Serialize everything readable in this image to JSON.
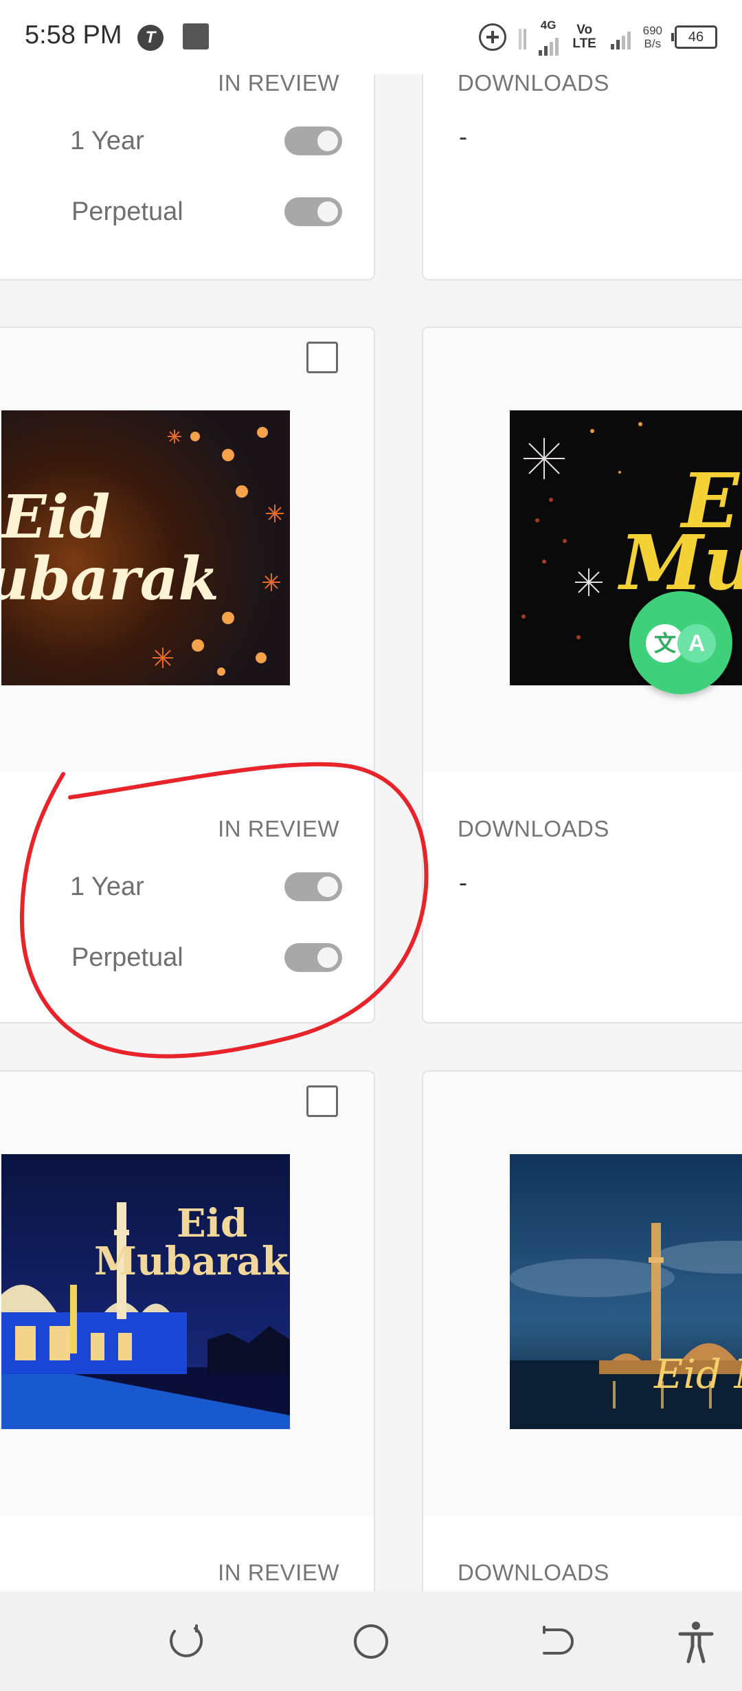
{
  "status_bar": {
    "time": "5:58 PM",
    "app_icon": "T",
    "network_4g": "4G",
    "volte": "Vo LTE",
    "speed_value": "690",
    "speed_unit": "B/s",
    "battery": "46"
  },
  "cards": [
    {
      "status": "IN REVIEW",
      "options": [
        {
          "label": "1 Year",
          "enabled": true
        },
        {
          "label": "Perpetual",
          "enabled": true
        }
      ],
      "downloads_label": "DOWNLOADS",
      "downloads_value": "-"
    },
    {
      "image_text": [
        "Eid",
        "ubarak"
      ],
      "right_image_text": [
        "E",
        "Mu"
      ],
      "status": "IN REVIEW",
      "options": [
        {
          "label": "1 Year",
          "enabled": true
        },
        {
          "label": "Perpetual",
          "enabled": true
        }
      ],
      "downloads_label": "DOWNLOADS",
      "downloads_value": "-"
    },
    {
      "image_text": [
        "Eid",
        "Mubarak"
      ],
      "right_image_text": [
        "Eid M"
      ],
      "status": "IN REVIEW",
      "downloads_label": "DOWNLOADS"
    }
  ],
  "translate_fab": {
    "glyph_1": "文",
    "glyph_2": "A"
  },
  "colors": {
    "annotation": "#e8232a",
    "fab": "#3ed07a",
    "toggle": "#a8a8a8"
  }
}
